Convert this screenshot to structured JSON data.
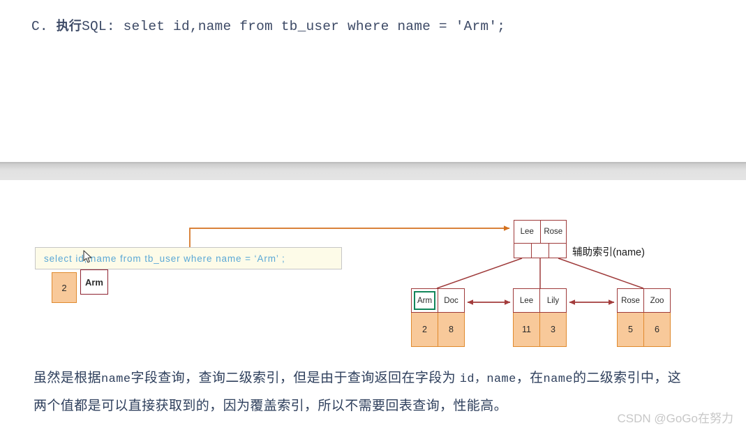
{
  "top": {
    "heading_prefix": "C. ",
    "heading_cn": "执行",
    "heading_sql": "SQL: selet id,name from tb_user where name = 'Arm';"
  },
  "diagram": {
    "sql_box": {
      "text": "select  id, name  from  tb_user  where  name = ‘Arm’ ;"
    },
    "result": {
      "id_value": "2",
      "name_value": "Arm"
    },
    "index_label": "辅助索引(name)",
    "root_node": {
      "keys": [
        "Lee",
        "Rose"
      ],
      "pointer_count": 3
    },
    "leaf_nodes": [
      {
        "keys": [
          "Arm",
          "Doc"
        ],
        "values": [
          "2",
          "8"
        ],
        "highlight_index": 0
      },
      {
        "keys": [
          "Lee",
          "Lily"
        ],
        "values": [
          "11",
          "3"
        ],
        "highlight_index": -1
      },
      {
        "keys": [
          "Rose",
          "Zoo"
        ],
        "values": [
          "5",
          "6"
        ],
        "highlight_index": -1
      }
    ],
    "colors": {
      "node_border": "#9e3a3a",
      "value_fill": "#f8c99a",
      "value_border": "#e08a2e",
      "highlight": "#12865a",
      "query_arrow": "#d4711e",
      "sql_text": "#5ba8d6",
      "sql_bg": "#fdfbe8"
    }
  },
  "bottom": {
    "line1_a": "虽然是根据",
    "line1_mono_a": "name",
    "line1_b": "字段查询，查询二级索引，但是由于查询返回在字段为 ",
    "line1_mono_b": "id，name",
    "line1_c": "，在",
    "line1_mono_c": "name",
    "line1_d": "的二级索",
    "line2": "引中，这两个值都是可以直接获取到的，因为覆盖索引，所以不需要回表查询，性能高。"
  },
  "watermark": "CSDN @GoGo在努力"
}
